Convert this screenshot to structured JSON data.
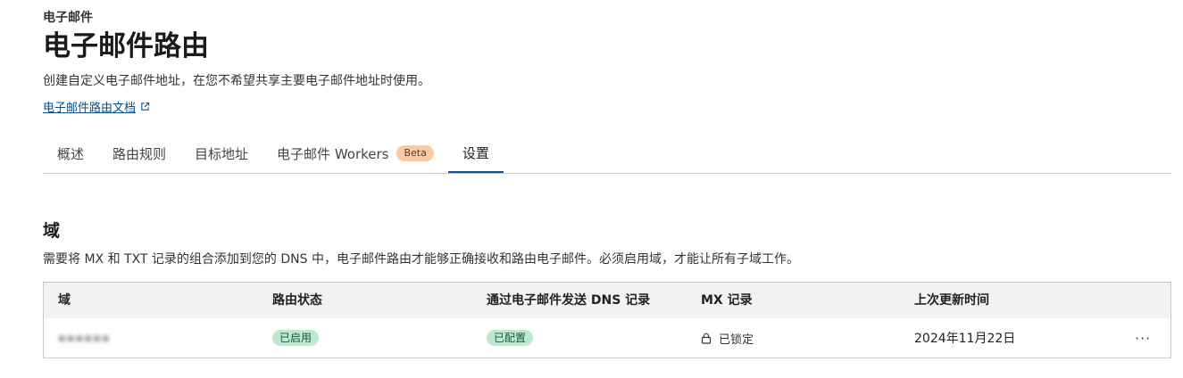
{
  "header": {
    "breadcrumb": "电子邮件",
    "title": "电子邮件路由",
    "description": "创建自定义电子邮件地址，在您不希望共享主要电子邮件地址时使用。",
    "doc_link": "电子邮件路由文档"
  },
  "tabs": [
    {
      "label": "概述"
    },
    {
      "label": "路由规则"
    },
    {
      "label": "目标地址"
    },
    {
      "label": "电子邮件 Workers",
      "badge": "Beta"
    },
    {
      "label": "设置",
      "active": true
    }
  ],
  "domains_section": {
    "title": "域",
    "description": "需要将 MX 和 TXT 记录的组合添加到您的 DNS 中，电子邮件路由才能够正确接收和路由电子邮件。必须启用域，才能让所有子域工作。",
    "columns": [
      "域",
      "路由状态",
      "通过电子邮件发送 DNS 记录",
      "MX 记录",
      "上次更新时间"
    ],
    "rows": [
      {
        "domain": "▪▪▪▪▪▪",
        "routing_status": "已启用",
        "dns_records": "已配置",
        "mx_records": "已锁定",
        "last_updated": "2024年11月22日",
        "more": "···"
      }
    ]
  },
  "colors": {
    "accent": "#0b4f8a",
    "beta_badge": "#fbc9a2",
    "success_badge": "#bfe9cf",
    "header_bg": "#f2f2f2",
    "border": "#c9c9c9"
  },
  "icons": {
    "doc_link": "external-link-icon",
    "mx_records": "lock-icon",
    "row_action": "more-horizontal-icon"
  }
}
